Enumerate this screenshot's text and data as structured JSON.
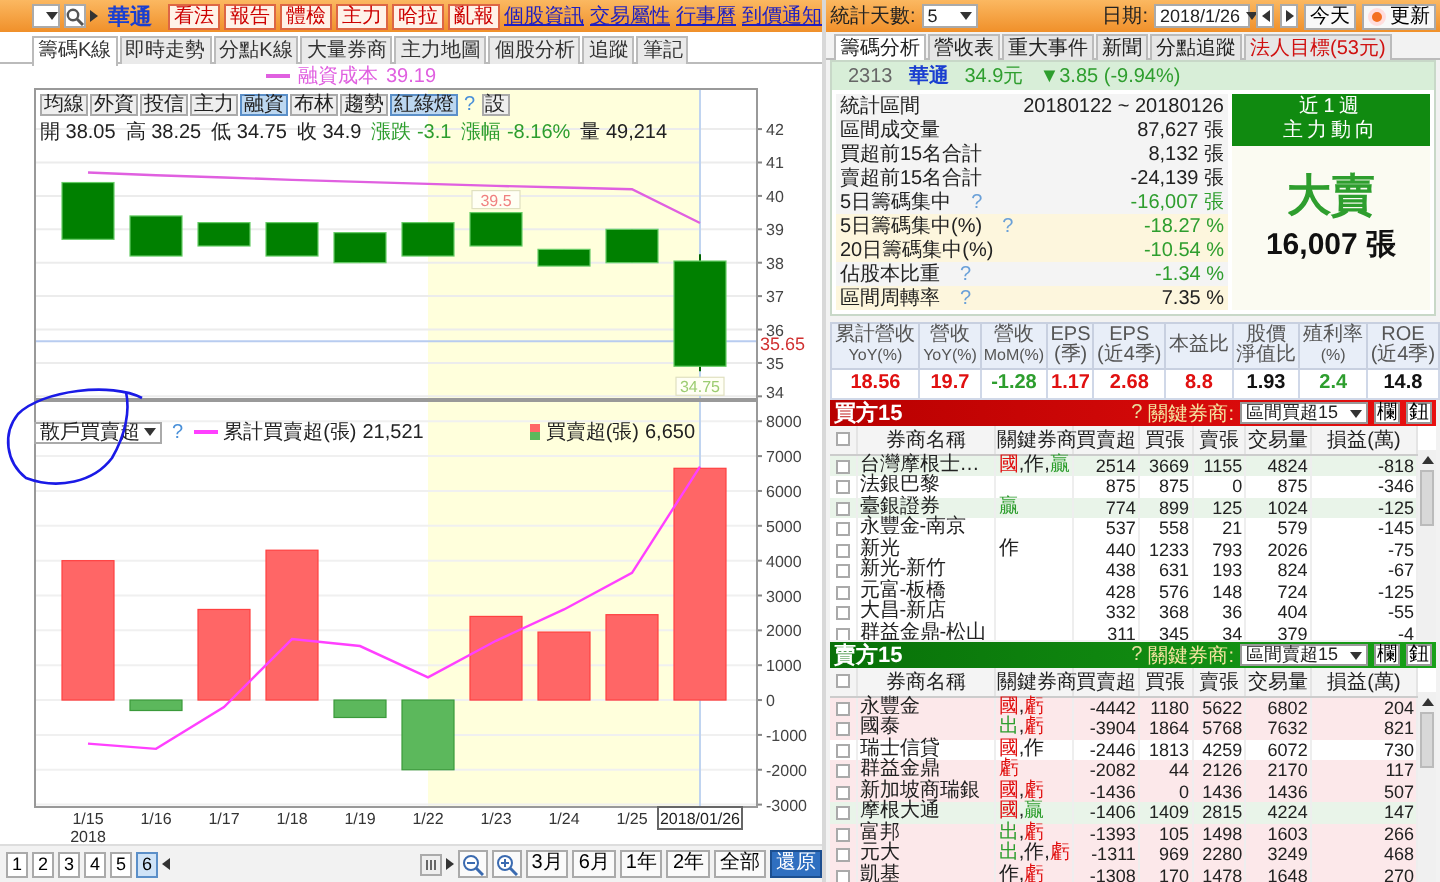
{
  "left": {
    "stock_name": "華通",
    "action_buttons": [
      "看法",
      "報告",
      "體檢",
      "主力",
      "哈拉",
      "亂報"
    ],
    "links": [
      "個股資訊",
      "交易屬性",
      "行事曆",
      "到價通知"
    ],
    "tabs": [
      {
        "label": "籌碼K線",
        "selected": true
      },
      {
        "label": "即時走勢",
        "selected": false
      },
      {
        "label": "分點K線",
        "selected": false
      },
      {
        "label": "大量券商",
        "selected": false
      },
      {
        "label": "主力地圖",
        "selected": false
      },
      {
        "label": "個股分析",
        "selected": false
      },
      {
        "label": "追蹤",
        "selected": false
      },
      {
        "label": "筆記",
        "selected": false
      }
    ],
    "price_chart": {
      "legend_value": "39.19",
      "toolbar": [
        {
          "label": "均線",
          "kind": "button",
          "selected": false
        },
        {
          "label": "外資",
          "kind": "button",
          "selected": false
        },
        {
          "label": "投信",
          "kind": "button",
          "selected": false
        },
        {
          "label": "主力",
          "kind": "button",
          "selected": false
        },
        {
          "label": "融資",
          "kind": "button",
          "selected": true
        },
        {
          "label": "布林",
          "kind": "button",
          "selected": false
        },
        {
          "label": "趨勢",
          "kind": "button",
          "selected": false
        },
        {
          "label": "紅綠燈",
          "kind": "button",
          "selected": true
        },
        {
          "label": "?",
          "kind": "help"
        },
        {
          "label": "設",
          "kind": "button",
          "selected": false
        }
      ],
      "quote": [
        {
          "label": "開",
          "value": "38.05",
          "color": "#222222"
        },
        {
          "label": "高",
          "value": "38.25",
          "color": "#222222"
        },
        {
          "label": "低",
          "value": "34.75",
          "color": "#222222"
        },
        {
          "label": "收",
          "value": "34.9",
          "color": "#222222"
        },
        {
          "label": "漲跌",
          "value": "-3.1",
          "color": "#2e9e2e"
        },
        {
          "label": "漲幅",
          "value": "-8.16%",
          "color": "#2e9e2e"
        },
        {
          "label": "量",
          "value": "49,214",
          "color": "#222222"
        }
      ],
      "high_marker": "39.5",
      "low_marker": "34.75",
      "chart_data": {
        "type": "candlestick",
        "ohlc": [
          [
            40.4,
            40.4,
            38.7,
            38.7
          ],
          [
            39.4,
            39.4,
            38.2,
            38.2
          ],
          [
            39.2,
            39.2,
            38.5,
            38.5
          ],
          [
            39.2,
            39.2,
            38.2,
            38.2
          ],
          [
            38.9,
            38.9,
            38.0,
            38.0
          ],
          [
            39.2,
            39.2,
            38.2,
            38.2
          ],
          [
            39.5,
            39.5,
            38.5,
            38.5
          ],
          [
            38.4,
            38.4,
            37.9,
            37.9
          ],
          [
            39.0,
            39.0,
            38.0,
            38.0
          ],
          [
            38.05,
            38.25,
            34.75,
            34.9
          ]
        ],
        "series": [
          {
            "name": "融資成本",
            "type": "line",
            "color": "#e060e0",
            "values": [
              40.7,
              40.62,
              40.55,
              40.48,
              40.42,
              40.36,
              40.3,
              40.25,
              40.2,
              39.19
            ]
          }
        ],
        "grid": true,
        "ref_lines": [
          {
            "axis": "y",
            "value": 35.65,
            "label": "35.65",
            "color": "#b8ccf0"
          }
        ],
        "ylim": [
          33.89,
          43.23
        ],
        "yticks": [
          34,
          35,
          36,
          37,
          38,
          39,
          40,
          41,
          42
        ]
      }
    },
    "flow_chart": {
      "indicator": "散戶買賣超",
      "hint": "?",
      "legend": [
        {
          "kind": "line",
          "value": "21,521"
        },
        {
          "kind": "bar",
          "value": "6,650"
        }
      ],
      "year_label": "2018",
      "annotations": [
        {
          "kind": "ink-circle",
          "color": "#1a1ae6"
        }
      ],
      "chart_data": {
        "type": "bar",
        "legend": "top",
        "categories": [
          "1/15",
          "1/16",
          "1/17",
          "1/18",
          "1/19",
          "1/22",
          "1/23",
          "1/24",
          "1/25",
          "2018/01/26"
        ],
        "series": [
          {
            "name": "買賣超(張)",
            "type": "bar",
            "color": "#ff6666",
            "colors": [
              "#ff6666",
              "#5cb85c",
              "#ff6666",
              "#ff6666",
              "#5cb85c",
              "#5cb85c",
              "#ff6666",
              "#ff6666",
              "#ff6666",
              "#ff6666"
            ],
            "values": [
              4000,
              -300,
              2600,
              4300,
              -500,
              -2000,
              2400,
              1950,
              2450,
              6650
            ]
          },
          {
            "name": "累計買賣超(張)",
            "type": "line",
            "color": "#ff40ff",
            "values": [
              -1250,
              -1400,
              -200,
              1750,
              1550,
              650,
              1700,
              2600,
              3650,
              6700
            ]
          }
        ],
        "grid": true,
        "bands": [
          {
            "axis": "x",
            "from": "1/22",
            "to": "2018/01/26",
            "color": "#ffffdc"
          }
        ],
        "ref_lines": [
          {
            "axis": "x",
            "value": "2018/01/26",
            "color": "#c0d4f0"
          }
        ],
        "ylim": [
          -3040,
          8610
        ],
        "yticks": [
          -3000,
          -2000,
          -1000,
          0,
          1000,
          2000,
          3000,
          4000,
          5000,
          6000,
          7000,
          8000
        ]
      }
    },
    "pages": [
      {
        "label": "1",
        "selected": false
      },
      {
        "label": "2",
        "selected": false
      },
      {
        "label": "3",
        "selected": false
      },
      {
        "label": "4",
        "selected": false
      },
      {
        "label": "5",
        "selected": false
      },
      {
        "label": "6",
        "selected": true
      }
    ],
    "range_buttons": [
      {
        "label": "3月",
        "selected": false
      },
      {
        "label": "6月",
        "selected": false
      },
      {
        "label": "1年",
        "selected": false
      },
      {
        "label": "2年",
        "selected": false
      },
      {
        "label": "全部",
        "selected": false
      },
      {
        "label": "還原",
        "selected": true
      }
    ]
  },
  "right": {
    "days_label": "統計天數:",
    "days_value": "5",
    "date_label": "日期:",
    "date_value": "2018/1/26",
    "today_button": "今天",
    "refresh_button": "更新",
    "tabs": [
      {
        "label": "籌碼分析",
        "selected": true,
        "color": "#222222"
      },
      {
        "label": "營收表",
        "selected": false,
        "color": "#222222"
      },
      {
        "label": "重大事件",
        "selected": false,
        "color": "#222222"
      },
      {
        "label": "新聞",
        "selected": false,
        "color": "#222222"
      },
      {
        "label": "分點追蹤",
        "selected": false,
        "color": "#222222"
      },
      {
        "label": "法人目標(53元)",
        "selected": false,
        "color": "#d01010"
      }
    ],
    "stock": {
      "code": "2313",
      "name": "華通",
      "price": "34.9元",
      "change": "▼3.85 (-9.94%)"
    },
    "stats": [
      {
        "label": "統計區間",
        "value": "20180122 ~ 20180126",
        "highlight": false,
        "color": "#222222"
      },
      {
        "label": "區間成交量",
        "value": "87,627 張",
        "highlight": false,
        "color": "#222222"
      },
      {
        "label": "買超前15名合計",
        "value": "8,132 張",
        "highlight": false,
        "color": "#222222"
      },
      {
        "label": "賣超前15名合計",
        "value": "-24,139 張",
        "highlight": false,
        "color": "#222222"
      },
      {
        "label": "5日籌碼集中",
        "hint": "?",
        "value": "-16,007 張",
        "highlight": false,
        "color": "#2e9e2e"
      },
      {
        "label": "5日籌碼集中(%)",
        "hint": "?",
        "value": "-18.27 %",
        "highlight": true,
        "color": "#2e9e2e"
      },
      {
        "label": "20日籌碼集中(%)",
        "value": "-10.54 %",
        "highlight": true,
        "color": "#2e9e2e"
      },
      {
        "label": "佔股本比重",
        "hint": "?",
        "value": "-1.34 %",
        "highlight": false,
        "color": "#2e9e2e"
      },
      {
        "label": "區間周轉率",
        "hint": "?",
        "value": "7.35 %",
        "highlight": true,
        "color": "#222222"
      }
    ],
    "trend": {
      "period": "近1週",
      "title": "主力動向",
      "verdict": "大賣",
      "amount": "16,007 張"
    },
    "fundamentals": [
      {
        "title": "累計營收",
        "unit": "YoY(%)",
        "value": "18.56",
        "color": "#e01010"
      },
      {
        "title": "營收",
        "unit": "YoY(%)",
        "value": "19.7",
        "color": "#e01010"
      },
      {
        "title": "營收",
        "unit": "MoM(%)",
        "value": "-1.28",
        "color": "#2e9e2e"
      },
      {
        "title": "EPS",
        "unit": "(季)",
        "value": "1.17",
        "color": "#e01010"
      },
      {
        "title": "EPS",
        "unit": "(近4季)",
        "value": "2.68",
        "color": "#e01010"
      },
      {
        "title": "本益比",
        "value": "8.8",
        "color": "#e01010"
      },
      {
        "title": "股價",
        "unit": "淨值比",
        "value": "1.93",
        "color": "#111111"
      },
      {
        "title": "殖利率",
        "unit": "(%)",
        "value": "2.4",
        "color": "#2e9e2e"
      },
      {
        "title": "ROE",
        "unit": "(近4季)",
        "value": "14.8",
        "color": "#111111"
      }
    ],
    "panels": [
      {
        "title": "買方15",
        "kind": "buy",
        "hint": "?",
        "filter_label": "關鍵券商:",
        "filter_value": "區間買超15",
        "buttons": [
          "欄",
          "鈕"
        ],
        "name_column": "券商名稱",
        "tag_column": "關鍵券商",
        "columns": [
          "買賣超",
          "買張",
          "賣張",
          "交易量",
          "損益(萬)"
        ],
        "all_checked": false,
        "rows": [
          {
            "checked": false,
            "color": "#e9f4e9",
            "name": "台灣摩根士…",
            "tags": [
              {
                "text": "國",
                "color": "#e01010"
              },
              {
                "text": ","
              },
              {
                "text": "作"
              },
              {
                "text": ","
              },
              {
                "text": "贏",
                "color": "#2e9e2e"
              }
            ],
            "cells": [
              "2514",
              "3669",
              "1155",
              "4824",
              "-818"
            ]
          },
          {
            "checked": false,
            "color": "#ffffff",
            "name": "法銀巴黎",
            "tags": [],
            "cells": [
              "875",
              "875",
              "0",
              "875",
              "-346"
            ]
          },
          {
            "checked": false,
            "color": "#e9f4e9",
            "name": "臺銀證券",
            "tags": [
              {
                "text": "贏",
                "color": "#2e9e2e"
              }
            ],
            "cells": [
              "774",
              "899",
              "125",
              "1024",
              "-125"
            ]
          },
          {
            "checked": false,
            "color": "#ffffff",
            "name": "永豐金-南京",
            "tags": [],
            "cells": [
              "537",
              "558",
              "21",
              "579",
              "-145"
            ]
          },
          {
            "checked": false,
            "color": "#ffffff",
            "name": "新光",
            "tags": [
              {
                "text": "作"
              }
            ],
            "cells": [
              "440",
              "1233",
              "793",
              "2026",
              "-75"
            ]
          },
          {
            "checked": false,
            "color": "#ffffff",
            "name": "新光-新竹",
            "tags": [],
            "cells": [
              "438",
              "631",
              "193",
              "824",
              "-67"
            ]
          },
          {
            "checked": false,
            "color": "#ffffff",
            "name": "元富-板橋",
            "tags": [],
            "cells": [
              "428",
              "576",
              "148",
              "724",
              "-125"
            ]
          },
          {
            "checked": false,
            "color": "#ffffff",
            "name": "大昌-新店",
            "tags": [],
            "cells": [
              "332",
              "368",
              "36",
              "404",
              "-55"
            ]
          },
          {
            "checked": false,
            "color": "#ffffff",
            "name": "群益金鼎-松山",
            "tags": [],
            "cells": [
              "311",
              "345",
              "34",
              "379",
              "-4"
            ]
          }
        ]
      },
      {
        "title": "賣方15",
        "kind": "sell",
        "hint": "?",
        "filter_label": "關鍵券商:",
        "filter_value": "區間賣超15",
        "buttons": [
          "欄",
          "鈕"
        ],
        "name_column": "券商名稱",
        "tag_column": "關鍵券商",
        "columns": [
          "買賣超",
          "買張",
          "賣張",
          "交易量",
          "損益(萬)"
        ],
        "all_checked": false,
        "rows": [
          {
            "checked": false,
            "color": "#fce8ea",
            "name": "永豐金",
            "tags": [
              {
                "text": "國",
                "color": "#e01010"
              },
              {
                "text": ","
              },
              {
                "text": "虧",
                "color": "#e01010"
              }
            ],
            "cells": [
              "-4442",
              "1180",
              "5622",
              "6802",
              "204"
            ]
          },
          {
            "checked": false,
            "color": "#fce8ea",
            "name": "國泰",
            "tags": [
              {
                "text": "出",
                "color": "#2e9e2e"
              },
              {
                "text": ","
              },
              {
                "text": "虧",
                "color": "#e01010"
              }
            ],
            "cells": [
              "-3904",
              "1864",
              "5768",
              "7632",
              "821"
            ]
          },
          {
            "checked": false,
            "color": "#ffffff",
            "name": "瑞士信貸",
            "tags": [
              {
                "text": "國",
                "color": "#e01010"
              },
              {
                "text": ","
              },
              {
                "text": "作"
              }
            ],
            "cells": [
              "-2446",
              "1813",
              "4259",
              "6072",
              "730"
            ]
          },
          {
            "checked": false,
            "color": "#fce8ea",
            "name": "群益金鼎",
            "tags": [
              {
                "text": "虧",
                "color": "#e01010"
              }
            ],
            "cells": [
              "-2082",
              "44",
              "2126",
              "2170",
              "117"
            ]
          },
          {
            "checked": false,
            "color": "#fce8ea",
            "name": "新加坡商瑞銀",
            "tags": [
              {
                "text": "國",
                "color": "#e01010"
              },
              {
                "text": ","
              },
              {
                "text": "虧",
                "color": "#e01010"
              }
            ],
            "cells": [
              "-1436",
              "0",
              "1436",
              "1436",
              "507"
            ]
          },
          {
            "checked": false,
            "color": "#e9f4e9",
            "name": "摩根大通",
            "tags": [
              {
                "text": "國",
                "color": "#e01010"
              },
              {
                "text": ","
              },
              {
                "text": "贏",
                "color": "#2e9e2e"
              }
            ],
            "cells": [
              "-1406",
              "1409",
              "2815",
              "4224",
              "147"
            ]
          },
          {
            "checked": false,
            "color": "#fce8ea",
            "name": "富邦",
            "tags": [
              {
                "text": "出",
                "color": "#2e9e2e"
              },
              {
                "text": ","
              },
              {
                "text": "虧",
                "color": "#e01010"
              }
            ],
            "cells": [
              "-1393",
              "105",
              "1498",
              "1603",
              "266"
            ]
          },
          {
            "checked": false,
            "color": "#fce8ea",
            "name": "元大",
            "tags": [
              {
                "text": "出",
                "color": "#2e9e2e"
              },
              {
                "text": ","
              },
              {
                "text": "作"
              },
              {
                "text": ","
              },
              {
                "text": "虧",
                "color": "#e01010"
              }
            ],
            "cells": [
              "-1311",
              "969",
              "2280",
              "3249",
              "468"
            ]
          },
          {
            "checked": false,
            "color": "#fce8ea",
            "name": "凱基",
            "tags": [
              {
                "text": "作"
              },
              {
                "text": ","
              },
              {
                "text": "虧",
                "color": "#e01010"
              }
            ],
            "cells": [
              "-1308",
              "170",
              "1478",
              "1648",
              "270"
            ]
          }
        ]
      }
    ]
  }
}
